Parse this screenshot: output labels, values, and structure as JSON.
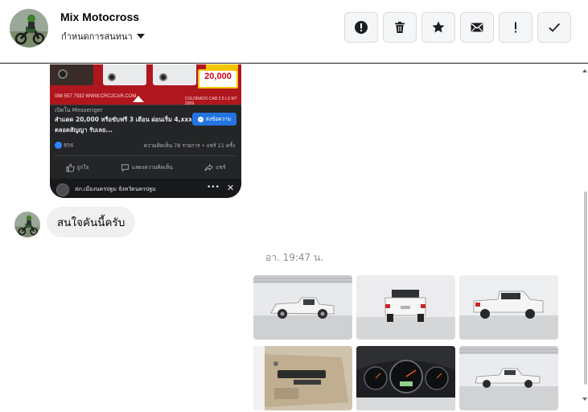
{
  "header": {
    "contact_name": "Mix Motocross",
    "status_label": "กำหนดการสนทนา",
    "toolbar": [
      {
        "name": "report-button",
        "icon": "alert-circle-icon"
      },
      {
        "name": "delete-button",
        "icon": "trash-icon"
      },
      {
        "name": "star-button",
        "icon": "star-icon"
      },
      {
        "name": "mark-unread-button",
        "icon": "envelope-icon"
      },
      {
        "name": "follow-up-button",
        "icon": "exclamation-icon"
      },
      {
        "name": "done-button",
        "icon": "check-icon"
      }
    ]
  },
  "shared_post": {
    "ad_price": "20,000",
    "ad_url": "088 557 7932  WWW.CRC2CAR.COM",
    "ad_model": "COLORADO CAB 2.5 LS MT 2009",
    "open_in": "เปิดใน Messenger",
    "text_line1": "สำแดด 20,000 หรือขับฟรี 3 เดือน ผ่อนเริ่ม 4,xxx",
    "text_line2": "ตลอดสัญญา รับเลย...",
    "send_button": "ส่งข้อความ",
    "likes": "856",
    "stats": "ความคิดเห็น 78 รายการ • แชร์ 11 ครั้ง",
    "like_action": "ถูกใจ",
    "comment_action": "แสดงความคิดเห็น",
    "share_action": "แชร์",
    "page_name": "สภ.เมืองนครปฐม จังหวัดนครปฐม"
  },
  "messages": [
    {
      "text": "สนใจคันนี้ครับ"
    }
  ],
  "timestamp": "อา. 19:47 น.",
  "colors": {
    "accent": "#2374e1",
    "bubble": "#f0f0f0",
    "ad_red": "#b0161d"
  }
}
